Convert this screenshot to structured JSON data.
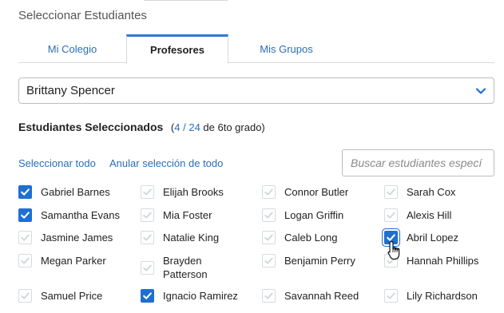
{
  "title": "Seleccionar Estudiantes",
  "tabs": [
    {
      "label": "Mi Colegio"
    },
    {
      "label": "Profesores"
    },
    {
      "label": "Mis Grupos"
    }
  ],
  "teacher_select": {
    "value": "Brittany Spencer"
  },
  "selected_summary": {
    "heading": "Estudiantes Seleccionados",
    "open": "(",
    "selected": "4",
    "sep": " / ",
    "total": "24",
    "suffix": " de 6to grado)"
  },
  "actions": {
    "select_all": "Seleccionar todo",
    "deselect_all": "Anular selección de todo"
  },
  "search": {
    "placeholder": "Buscar estudiantes especí"
  },
  "colors": {
    "accent": "#1f6fd1",
    "link": "#2a6fb8"
  },
  "students": [
    {
      "name": "Gabriel Barnes",
      "checked": true
    },
    {
      "name": "Elijah Brooks",
      "checked": false
    },
    {
      "name": "Connor Butler",
      "checked": false
    },
    {
      "name": "Sarah Cox",
      "checked": false
    },
    {
      "name": "Samantha Evans",
      "checked": true
    },
    {
      "name": "Mia Foster",
      "checked": false
    },
    {
      "name": "Logan Griffin",
      "checked": false
    },
    {
      "name": "Alexis Hill",
      "checked": false
    },
    {
      "name": "Jasmine James",
      "checked": false
    },
    {
      "name": "Natalie King",
      "checked": false
    },
    {
      "name": "Caleb Long",
      "checked": false
    },
    {
      "name": "Abril Lopez",
      "checked": true
    },
    {
      "name": "Megan Parker",
      "checked": false
    },
    {
      "name": "Brayden Patterson",
      "checked": false
    },
    {
      "name": "Benjamin Perry",
      "checked": false
    },
    {
      "name": "Hannah Phillips",
      "checked": false
    },
    {
      "name": "Samuel Price",
      "checked": false
    },
    {
      "name": "Ignacio Ramirez",
      "checked": true
    },
    {
      "name": "Savannah Reed",
      "checked": false
    },
    {
      "name": "Lily Richardson",
      "checked": false
    }
  ]
}
